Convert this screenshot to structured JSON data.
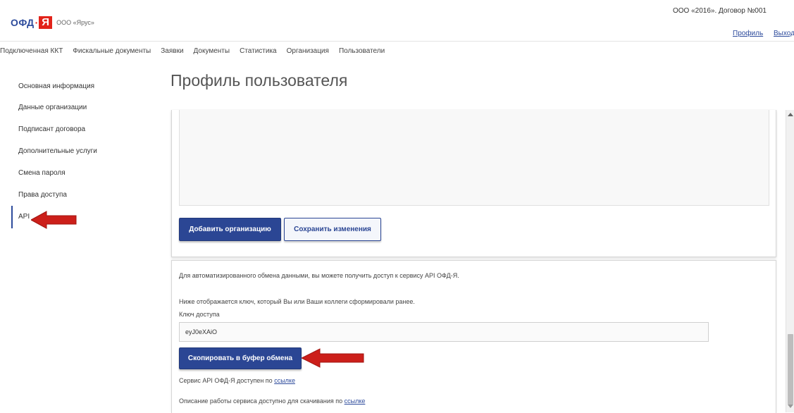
{
  "header": {
    "logo_ofd": "ОФД",
    "logo_dot": "·",
    "logo_ya": "Я",
    "org_name": "ООО «Ярус»",
    "contract": "ООО «2016». Договор №001",
    "profile_link": "Профиль",
    "logout_link": "Выход"
  },
  "topnav": {
    "items": [
      "Подключенная ККТ",
      "Фискальные документы",
      "Заявки",
      "Документы",
      "Статистика",
      "Организация",
      "Пользователи"
    ]
  },
  "sidebar": {
    "items": [
      "Основная информация",
      "Данные организации",
      "Подписант договора",
      "Дополнительные услуги",
      "Смена пароля",
      "Права доступа",
      "API"
    ],
    "active": "API"
  },
  "page": {
    "title": "Профиль пользователя"
  },
  "org_panel": {
    "add_button": "Добавить организацию",
    "save_button": "Сохранить изменения"
  },
  "api_panel": {
    "intro": "Для автоматизированного обмена данными, вы можете получить доступ к сервису API ОФД-Я.",
    "key_note": "Ниже отображается ключ, который Вы или Ваши коллеги сформировали ранее.",
    "key_label": "Ключ доступа",
    "key_value": "eyJ0eXAiO",
    "copy_button": "Скопировать в буфер обмена",
    "service_text": "Сервис API ОФД-Я доступен по",
    "service_link": "ссылке",
    "docs_text": "Описание работы сервиса доступно для скачивания по",
    "docs_link": "ссылке"
  },
  "colors": {
    "primary": "#2b4694",
    "arrow_red": "#cc1f1a",
    "logo_red": "#e2231a"
  }
}
